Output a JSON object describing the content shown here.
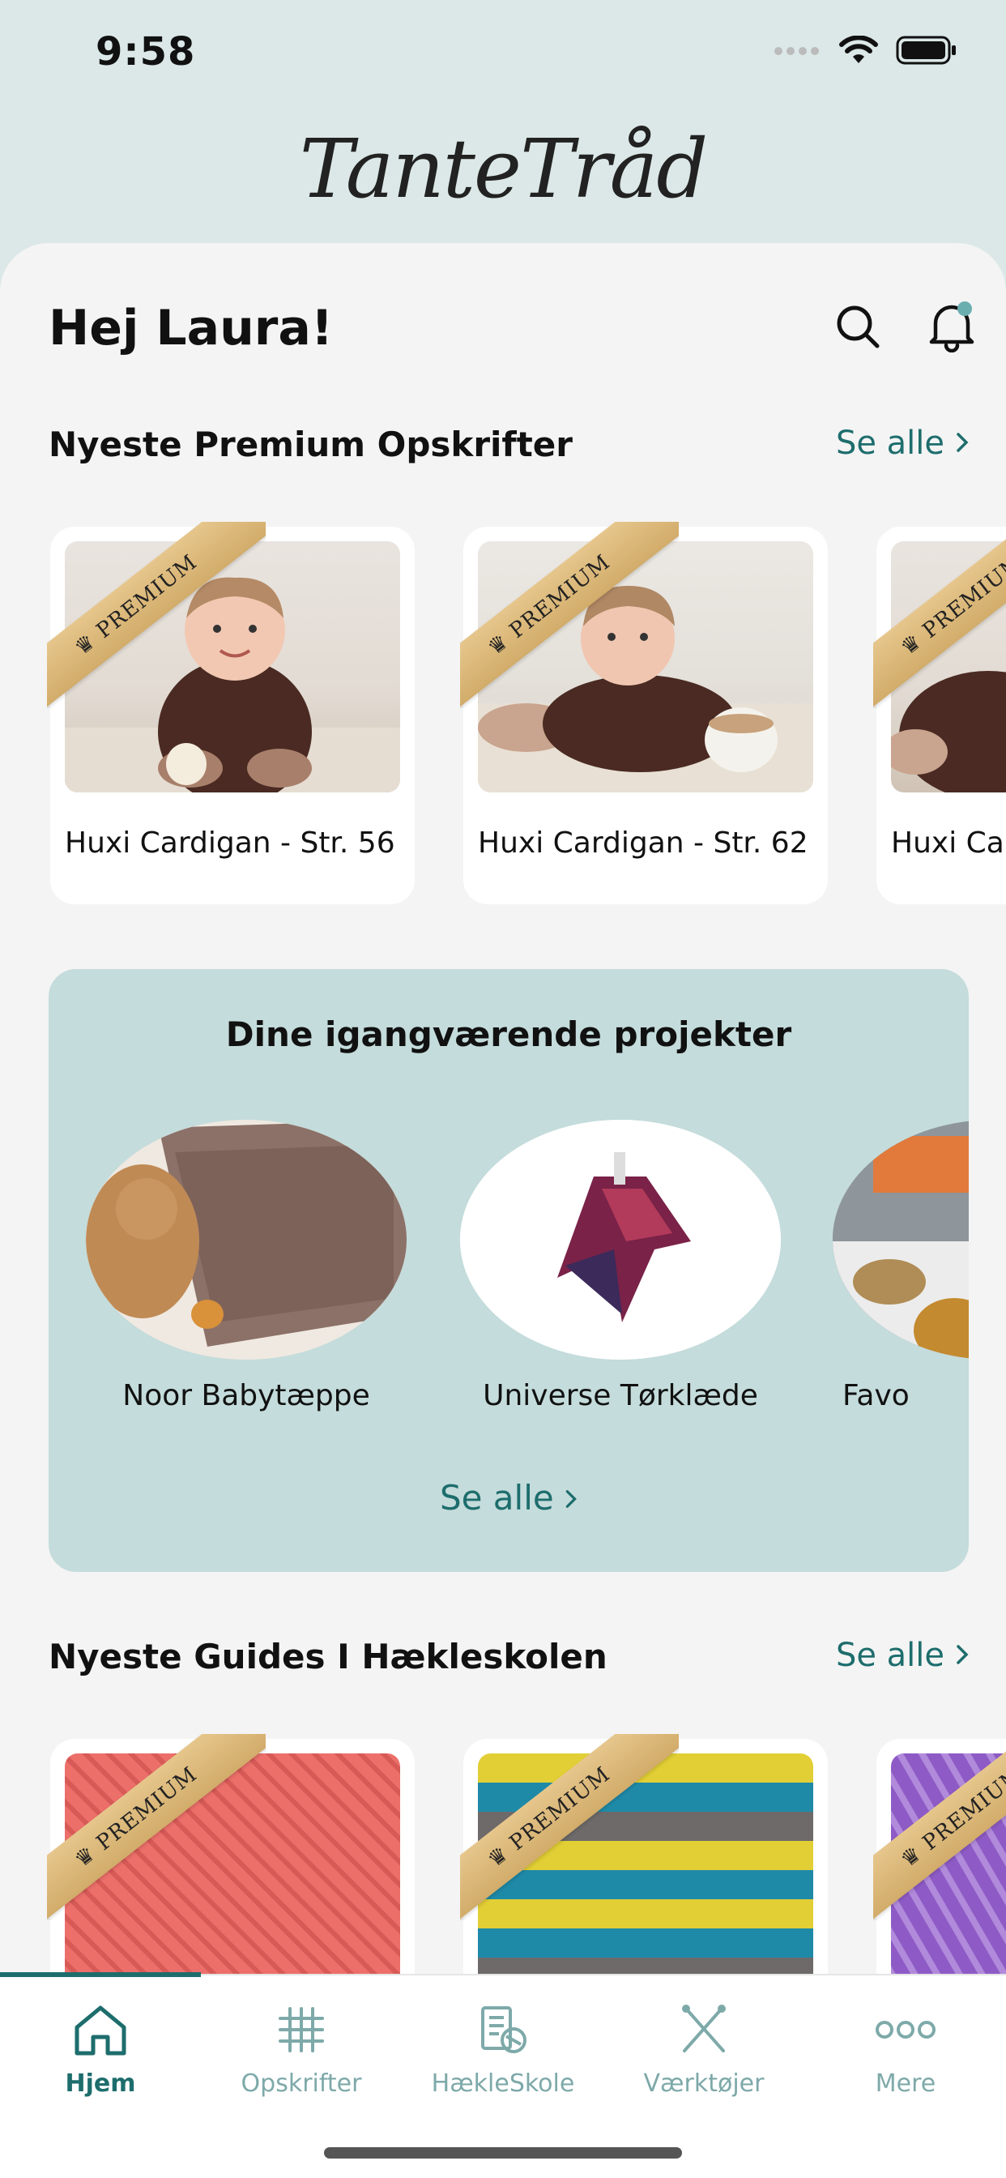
{
  "status_bar": {
    "time": "9:58",
    "icons": [
      "signal-icon",
      "wifi-icon",
      "battery-icon"
    ]
  },
  "header": {
    "logo_text": "TanteTråd"
  },
  "home": {
    "greeting": "Hej Laura!"
  },
  "premium_section": {
    "title": "Nyeste Premium Opskrifter",
    "see_all": "Se alle",
    "badge": "PREMIUM",
    "cards": [
      {
        "title": "Huxi Cardigan - Str. 56"
      },
      {
        "title": "Huxi Cardigan - Str. 62"
      },
      {
        "title": "Huxi Ca"
      }
    ]
  },
  "projects_section": {
    "title": "Dine igangværende projekter",
    "items": [
      {
        "label": "Noor Babytæppe"
      },
      {
        "label": "Universe Tørklæde"
      },
      {
        "label": "Favo"
      }
    ],
    "see_all": "Se alle"
  },
  "guides_section": {
    "title": "Nyeste Guides I Hækleskolen",
    "see_all": "Se alle",
    "badge": "PREMIUM"
  },
  "tab_bar": {
    "tabs": [
      {
        "label": "Hjem",
        "icon": "home-icon",
        "active": true
      },
      {
        "label": "Opskrifter",
        "icon": "grid-hash-icon",
        "active": false
      },
      {
        "label": "HækleSkole",
        "icon": "school-book-icon",
        "active": false
      },
      {
        "label": "Værktøjer",
        "icon": "crossed-needles-icon",
        "active": false
      },
      {
        "label": "Mere",
        "icon": "more-dots-icon",
        "active": false
      }
    ]
  },
  "colors": {
    "accent": "#1e6d6d",
    "background": "#dbe8e7",
    "sheet": "#f4f4f4",
    "projects_panel": "#c4dcdb",
    "ribbon": "#dcb878"
  }
}
